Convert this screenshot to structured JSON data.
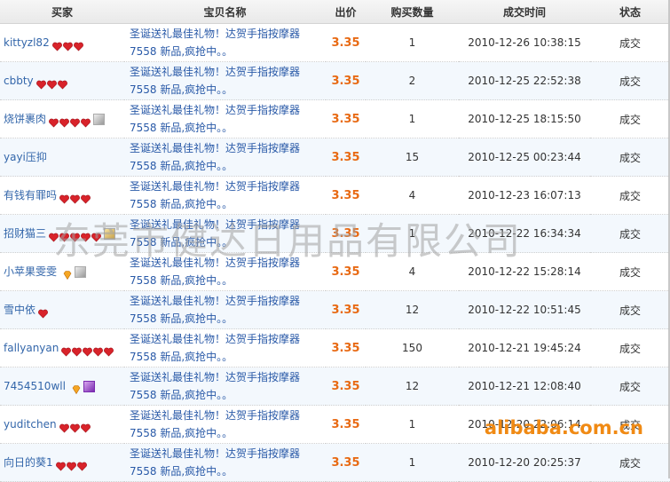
{
  "headers": {
    "buyer": "买家",
    "item": "宝贝名称",
    "price": "出价",
    "qty": "购买数量",
    "time": "成交时间",
    "status": "状态"
  },
  "rows": [
    {
      "buyer": "kittyzl82",
      "hearts": 3,
      "badge": "",
      "item_line1": "圣诞送礼最佳礼物！达贺手指按摩器",
      "item_line2": "7558 新品,疯抢中。。",
      "price": "3.35",
      "qty": "1",
      "time": "2010-12-26 10:38:15",
      "status": "成交"
    },
    {
      "buyer": "cbbty",
      "hearts": 3,
      "badge": "",
      "item_line1": "圣诞送礼最佳礼物！达贺手指按摩器",
      "item_line2": "7558 新品,疯抢中。。",
      "price": "3.35",
      "qty": "2",
      "time": "2010-12-25 22:52:38",
      "status": "成交"
    },
    {
      "buyer": "烧饼裹肉",
      "hearts": 4,
      "badge": "grey",
      "item_line1": "圣诞送礼最佳礼物！达贺手指按摩器",
      "item_line2": "7558 新品,疯抢中。。",
      "price": "3.35",
      "qty": "1",
      "time": "2010-12-25 18:15:50",
      "status": "成交"
    },
    {
      "buyer": "yayi压抑",
      "hearts": 0,
      "badge": "",
      "item_line1": "圣诞送礼最佳礼物！达贺手指按摩器",
      "item_line2": "7558 新品,疯抢中。。",
      "price": "3.35",
      "qty": "15",
      "time": "2010-12-25 00:23:44",
      "status": "成交"
    },
    {
      "buyer": "有钱有罪吗",
      "hearts": 3,
      "badge": "",
      "item_line1": "圣诞送礼最佳礼物！达贺手指按摩器",
      "item_line2": "7558 新品,疯抢中。。",
      "price": "3.35",
      "qty": "4",
      "time": "2010-12-23 16:07:13",
      "status": "成交"
    },
    {
      "buyer": "招财猫三",
      "hearts": 5,
      "badge": "gold",
      "item_line1": "圣诞送礼最佳礼物！达贺手指按摩器",
      "item_line2": "7558 新品,疯抢中。。",
      "price": "3.35",
      "qty": "1",
      "time": "2010-12-22 16:34:34",
      "status": "成交"
    },
    {
      "buyer": "小苹果雯雯",
      "hearts": 0,
      "diamond": true,
      "badge": "grey",
      "item_line1": "圣诞送礼最佳礼物！达贺手指按摩器",
      "item_line2": "7558 新品,疯抢中。。",
      "price": "3.35",
      "qty": "4",
      "time": "2010-12-22 15:28:14",
      "status": "成交"
    },
    {
      "buyer": "雪中依",
      "hearts": 1,
      "badge": "",
      "item_line1": "圣诞送礼最佳礼物！达贺手指按摩器",
      "item_line2": "7558 新品,疯抢中。。",
      "price": "3.35",
      "qty": "12",
      "time": "2010-12-22 10:51:45",
      "status": "成交"
    },
    {
      "buyer": "fallyanyan",
      "hearts": 5,
      "badge": "",
      "item_line1": "圣诞送礼最佳礼物！达贺手指按摩器",
      "item_line2": "7558 新品,疯抢中。。",
      "price": "3.35",
      "qty": "150",
      "time": "2010-12-21 19:45:24",
      "status": "成交"
    },
    {
      "buyer": "7454510wll",
      "hearts": 0,
      "diamond": true,
      "badge": "purple",
      "item_line1": "圣诞送礼最佳礼物！达贺手指按摩器",
      "item_line2": "7558 新品,疯抢中。。",
      "price": "3.35",
      "qty": "12",
      "time": "2010-12-21 12:08:40",
      "status": "成交"
    },
    {
      "buyer": "yuditchen",
      "hearts": 3,
      "badge": "",
      "item_line1": "圣诞送礼最佳礼物！达贺手指按摩器",
      "item_line2": "7558 新品,疯抢中。。",
      "price": "3.35",
      "qty": "1",
      "time": "2010-12-20 22:06:14",
      "status": "成交"
    },
    {
      "buyer": "向日的葵1",
      "hearts": 3,
      "badge": "",
      "item_line1": "圣诞送礼最佳礼物！达贺手指按摩器",
      "item_line2": "7558 新品,疯抢中。。",
      "price": "3.35",
      "qty": "1",
      "time": "2010-12-20 20:25:37",
      "status": "成交"
    }
  ],
  "watermark": "东莞市健达日用品有限公司",
  "logo": "alibaba.com.cn",
  "colors": {
    "price": "#e86a14",
    "link": "#3366aa",
    "heart": "#d8232a",
    "logo": "#f08a14"
  }
}
